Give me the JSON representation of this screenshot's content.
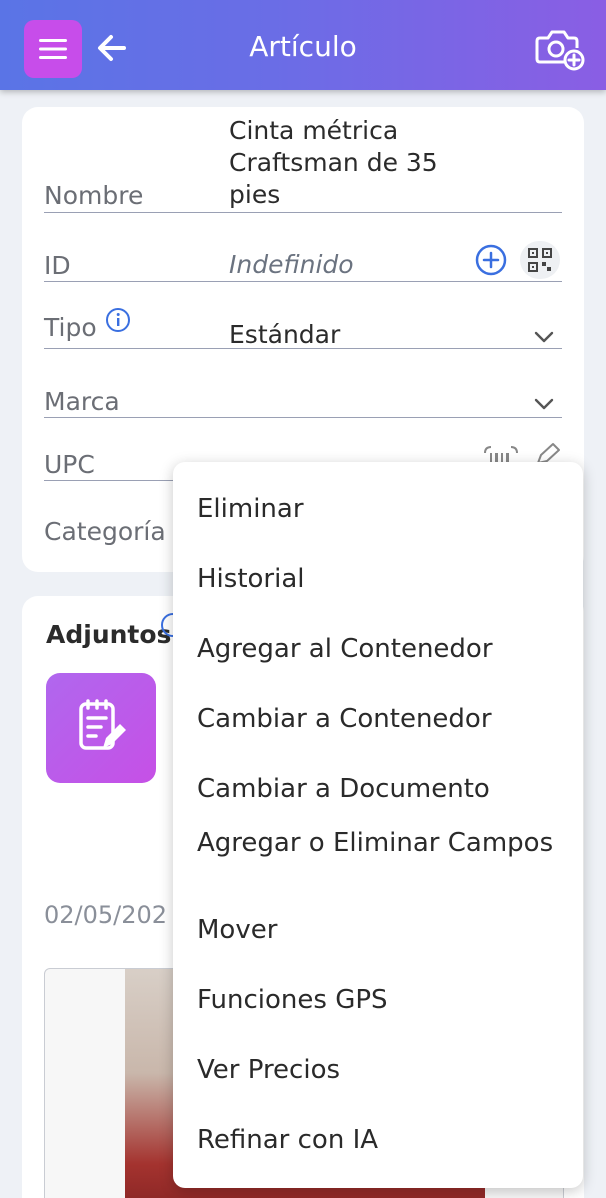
{
  "header": {
    "title": "Artículo"
  },
  "fields": {
    "nombre_label": "Nombre",
    "nombre_line1": "Cinta métrica",
    "nombre_line2": "Craftsman de 35",
    "nombre_line3": "pies",
    "id_label": "ID",
    "id_value": "Indefinido",
    "tipo_label": "Tipo",
    "tipo_value": "Estándar",
    "marca_label": "Marca",
    "upc_label": "UPC",
    "categoria_label": "Categoría"
  },
  "attachments": {
    "title": "Adjuntos",
    "date": "02/05/202"
  },
  "menu": {
    "items": [
      "Eliminar",
      "Historial",
      "Agregar al Contenedor",
      "Cambiar a Contenedor",
      "Cambiar a Documento",
      "Agregar o Eliminar Campos",
      "Mover",
      "Funciones GPS",
      "Ver Precios",
      "Refinar con IA"
    ]
  },
  "colors": {
    "accent": "#c74dea",
    "header_start": "#5a74e6",
    "header_end": "#8a5ee4",
    "link": "#3a6fe0"
  },
  "icons": [
    "menu-icon",
    "back-arrow-icon",
    "camera-add-icon",
    "info-icon",
    "add-circle-icon",
    "qr-code-icon",
    "chevron-down-icon",
    "barcode-scan-icon",
    "edit-pencil-icon",
    "document-edit-icon"
  ]
}
